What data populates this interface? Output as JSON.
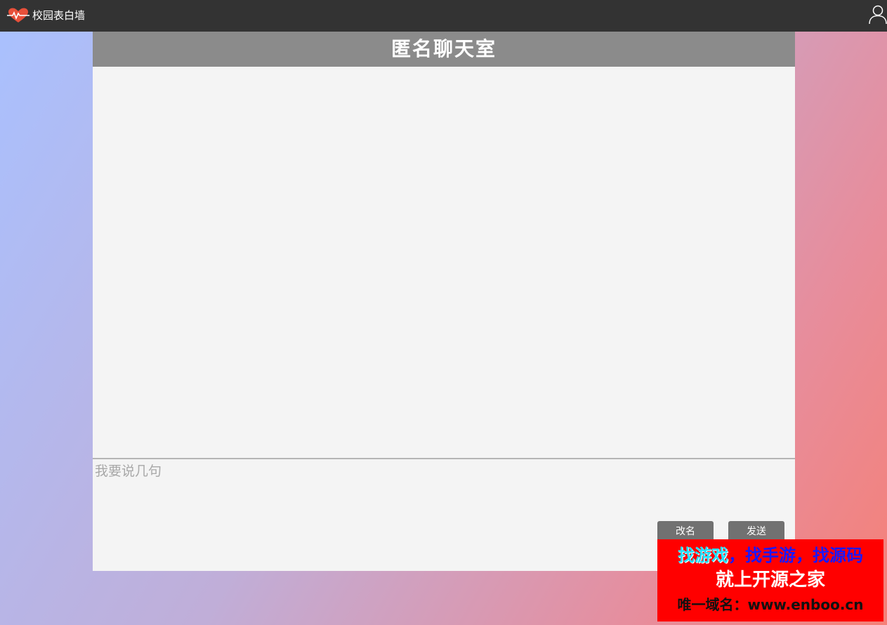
{
  "topbar": {
    "logo_icon": "heart-pulse-icon",
    "app_name": "校园表白墙",
    "user_icon": "user-icon"
  },
  "chat": {
    "title": "匿名聊天室",
    "messages": [],
    "input_placeholder": "我要说几句",
    "rename_label": "改名",
    "send_label": "发送"
  },
  "watermark": {
    "line1_part1": "找游戏",
    "line1_part2": "，找手游，找源码",
    "line2": "就上开源之家",
    "line3": "唯一域名：www.enboo.cn"
  },
  "colors": {
    "topbar_bg": "#333333",
    "header_bg": "#8b8b8b",
    "panel_bg": "#f4f4f4",
    "button_bg": "#717171",
    "logo_red": "#e8503a",
    "watermark_bg": "#ff0000"
  }
}
